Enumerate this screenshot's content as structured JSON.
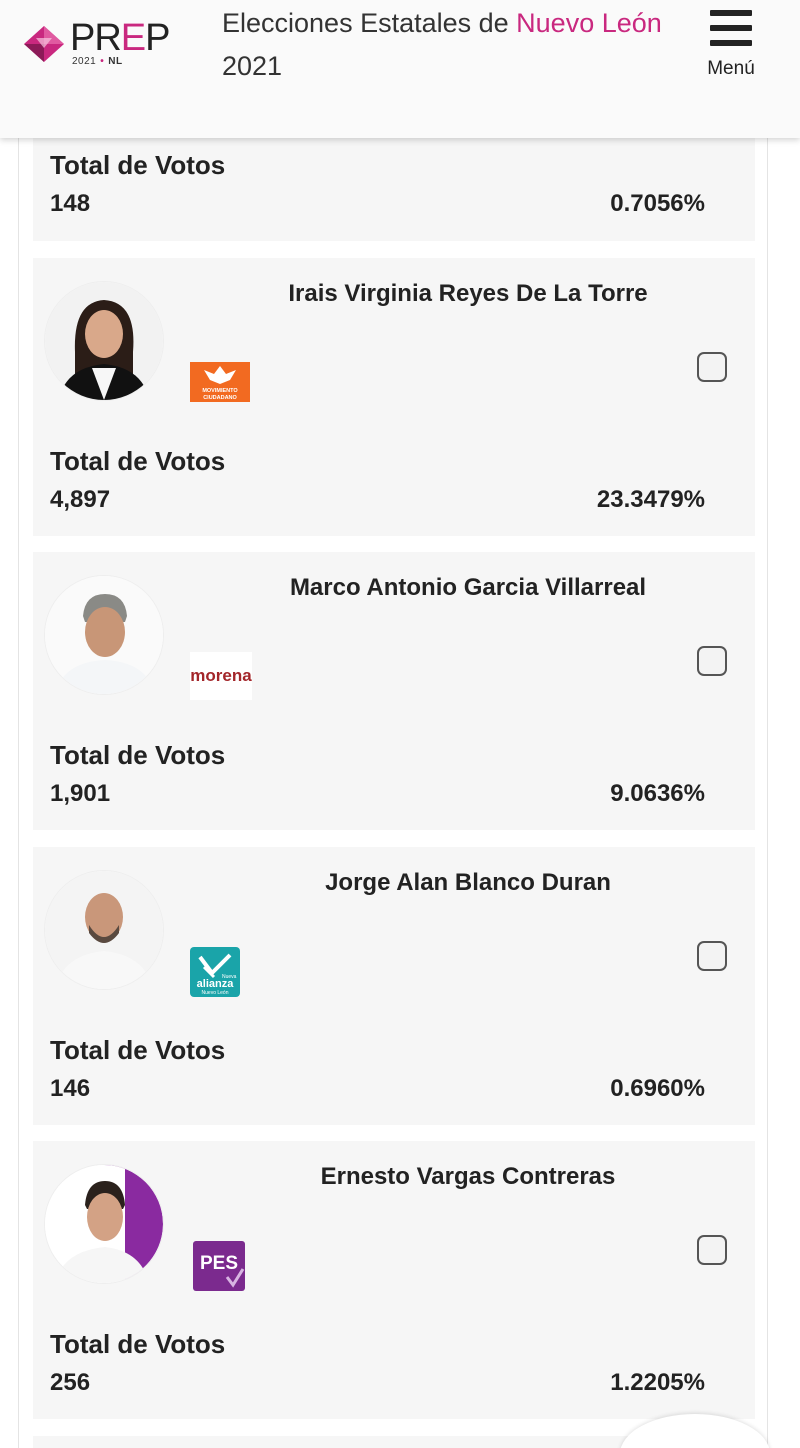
{
  "header": {
    "logo_word_pre": "PR",
    "logo_word_accent": "E",
    "logo_word_post": "P",
    "logo_year": "2021",
    "logo_state": "NL",
    "title_part1": "Elecciones Estatales de ",
    "title_accent": "Nuevo León",
    "title_part2": " 2021",
    "menu_label": "Menú"
  },
  "partial_card": {
    "votes_label": "Total de Votos",
    "votes": "148",
    "percent": "0.7056%"
  },
  "candidates": [
    {
      "name": "Irais Virginia Reyes De La Torre",
      "party": "MOVIMIENTO CIUDADANO",
      "party_color": "#f26a21",
      "votes_label": "Total de Votos",
      "votes": "4,897",
      "percent": "23.3479%"
    },
    {
      "name": "Marco Antonio Garcia Villarreal",
      "party": "morena",
      "party_color": "#a3262a",
      "votes_label": "Total de Votos",
      "votes": "1,901",
      "percent": "9.0636%"
    },
    {
      "name": "Jorge Alan Blanco Duran",
      "party": "alianza",
      "party_sub": "Nueva",
      "party_region": "Nuevo León",
      "party_color": "#1aa4a9",
      "votes_label": "Total de Votos",
      "votes": "146",
      "percent": "0.6960%"
    },
    {
      "name": "Ernesto Vargas Contreras",
      "party": "PES",
      "party_color": "#7b2a8e",
      "votes_label": "Total de Votos",
      "votes": "256",
      "percent": "1.2205%"
    }
  ],
  "colors": {
    "accent": "#c9287f",
    "card_bg": "#f6f6f6",
    "text": "#222222"
  }
}
